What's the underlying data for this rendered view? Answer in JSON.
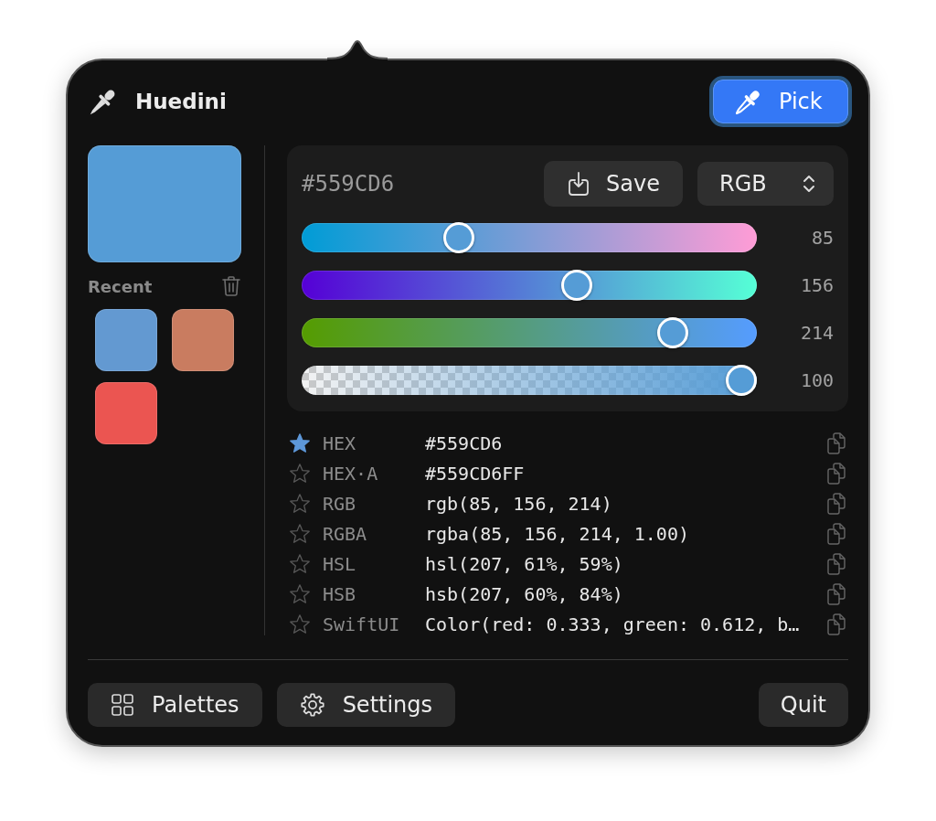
{
  "header": {
    "title": "Huedini",
    "pick_button": {
      "label": "Pick"
    }
  },
  "recent": {
    "title": "Recent",
    "swatches": [
      {
        "color": "#6399d1"
      },
      {
        "color": "#c97c60"
      },
      {
        "color": "#eb5551"
      }
    ]
  },
  "editor": {
    "hex": "#559CD6",
    "save_button": {
      "label": "Save"
    },
    "model": "RGB",
    "channels": [
      {
        "kind": "red",
        "level": 0.333,
        "reading": "85"
      },
      {
        "kind": "green",
        "level": 0.612,
        "reading": "156"
      },
      {
        "kind": "blue",
        "level": 0.839,
        "reading": "214"
      },
      {
        "kind": "alpha",
        "level": 1,
        "reading": "100"
      }
    ]
  },
  "formats": [
    {
      "label": "HEX",
      "value": "#559CD6",
      "favorite": true
    },
    {
      "label": "HEX·A",
      "value": "#559CD6FF",
      "favorite": false
    },
    {
      "label": "RGB",
      "value": "rgb(85, 156, 214)",
      "favorite": false
    },
    {
      "label": "RGBA",
      "value": "rgba(85, 156, 214, 1.00)",
      "favorite": false
    },
    {
      "label": "HSL",
      "value": "hsl(207, 61%, 59%)",
      "favorite": false
    },
    {
      "label": "HSB",
      "value": "hsb(207, 60%, 84%)",
      "favorite": false
    },
    {
      "label": "SwiftUI",
      "value": "Color(red: 0.333, green: 0.612, b…",
      "favorite": false
    }
  ],
  "footer": {
    "buttons": [
      {
        "kind": "palettes",
        "label": "Palettes"
      },
      {
        "kind": "settings",
        "label": "Settings"
      }
    ],
    "quit_button": {
      "label": "Quit"
    }
  }
}
